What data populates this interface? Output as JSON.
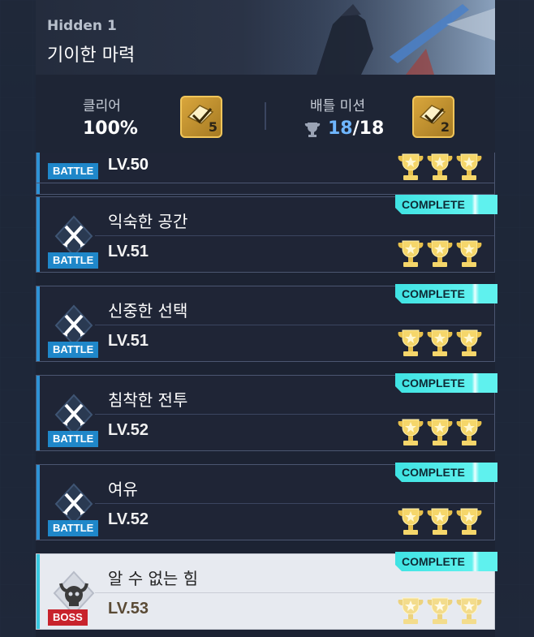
{
  "header": {
    "subtitle": "Hidden 1",
    "title": "기이한 마력"
  },
  "summary": {
    "clear_label": "클리어",
    "clear_value": "100%",
    "clear_reward_count": "5",
    "mission_label": "배틀 미션",
    "mission_done": "18",
    "mission_total": "/18",
    "mission_reward_count": "2"
  },
  "stages": [
    {
      "name": "",
      "level": "LV.50",
      "type": "BATTLE",
      "status": "",
      "trophies": 3
    },
    {
      "name": "익숙한 공간",
      "level": "LV.51",
      "type": "BATTLE",
      "status": "COMPLETE",
      "trophies": 3
    },
    {
      "name": "신중한 선택",
      "level": "LV.51",
      "type": "BATTLE",
      "status": "COMPLETE",
      "trophies": 3
    },
    {
      "name": "침착한 전투",
      "level": "LV.52",
      "type": "BATTLE",
      "status": "COMPLETE",
      "trophies": 3
    },
    {
      "name": "여유",
      "level": "LV.52",
      "type": "BATTLE",
      "status": "COMPLETE",
      "trophies": 3
    },
    {
      "name": "알 수 없는 힘",
      "level": "LV.53",
      "type": "BOSS",
      "status": "COMPLETE",
      "trophies": 3
    }
  ],
  "colors": {
    "accent": "#3fe3e3",
    "battle_tag": "#1f87c9",
    "boss_tag": "#c8232c",
    "trophy_gold": "#f5d66a"
  }
}
